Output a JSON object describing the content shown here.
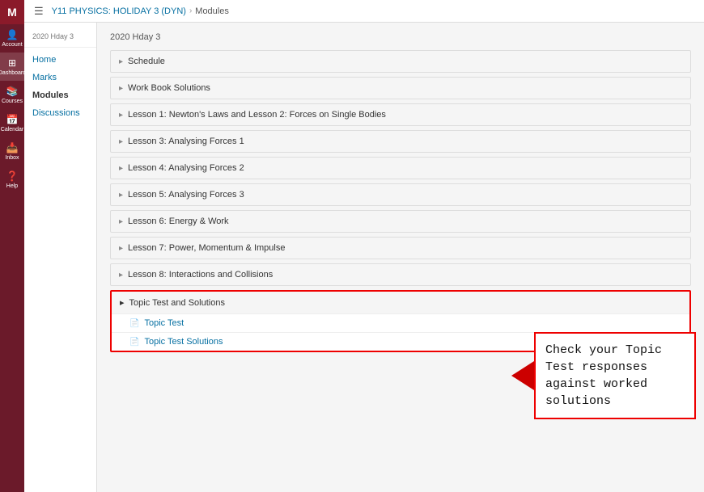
{
  "topbar": {
    "menu_icon": "☰",
    "breadcrumb_course": "Y11 PHYSICS: HOLIDAY 3 (DYN)",
    "breadcrumb_sep": "›",
    "breadcrumb_current": "Modules"
  },
  "sidebar_breadcrumb": "2020 Hday 3",
  "sidebar": {
    "items": [
      {
        "label": "Home",
        "active": false
      },
      {
        "label": "Marks",
        "active": false
      },
      {
        "label": "Modules",
        "active": true
      },
      {
        "label": "Discussions",
        "active": false
      }
    ]
  },
  "nav_rail": {
    "logo": "M",
    "items": [
      {
        "icon": "👤",
        "label": "Account"
      },
      {
        "icon": "⊞",
        "label": "Dashboard"
      },
      {
        "icon": "📚",
        "label": "Courses"
      },
      {
        "icon": "📅",
        "label": "Calendar"
      },
      {
        "icon": "📥",
        "label": "Inbox"
      },
      {
        "icon": "?",
        "label": "Help"
      }
    ]
  },
  "page_title": "2020 Hday 3",
  "modules": [
    {
      "label": "Schedule"
    },
    {
      "label": "Work Book Solutions"
    },
    {
      "label": "Lesson 1: Newton's Laws and Lesson 2: Forces on Single Bodies"
    },
    {
      "label": "Lesson 3: Analysing Forces 1"
    },
    {
      "label": "Lesson 4: Analysing Forces 2"
    },
    {
      "label": "Lesson 5: Analysing Forces 3"
    },
    {
      "label": "Lesson 6: Energy & Work"
    },
    {
      "label": "Lesson 7: Power, Momentum & Impulse"
    },
    {
      "label": "Lesson 8: Interactions and Collisions"
    }
  ],
  "topic_test": {
    "header": "Topic Test and Solutions",
    "sub_items": [
      {
        "label": "Topic Test"
      },
      {
        "label": "Topic Test Solutions"
      }
    ]
  },
  "callout": {
    "text": "Check your Topic Test responses against worked solutions"
  }
}
